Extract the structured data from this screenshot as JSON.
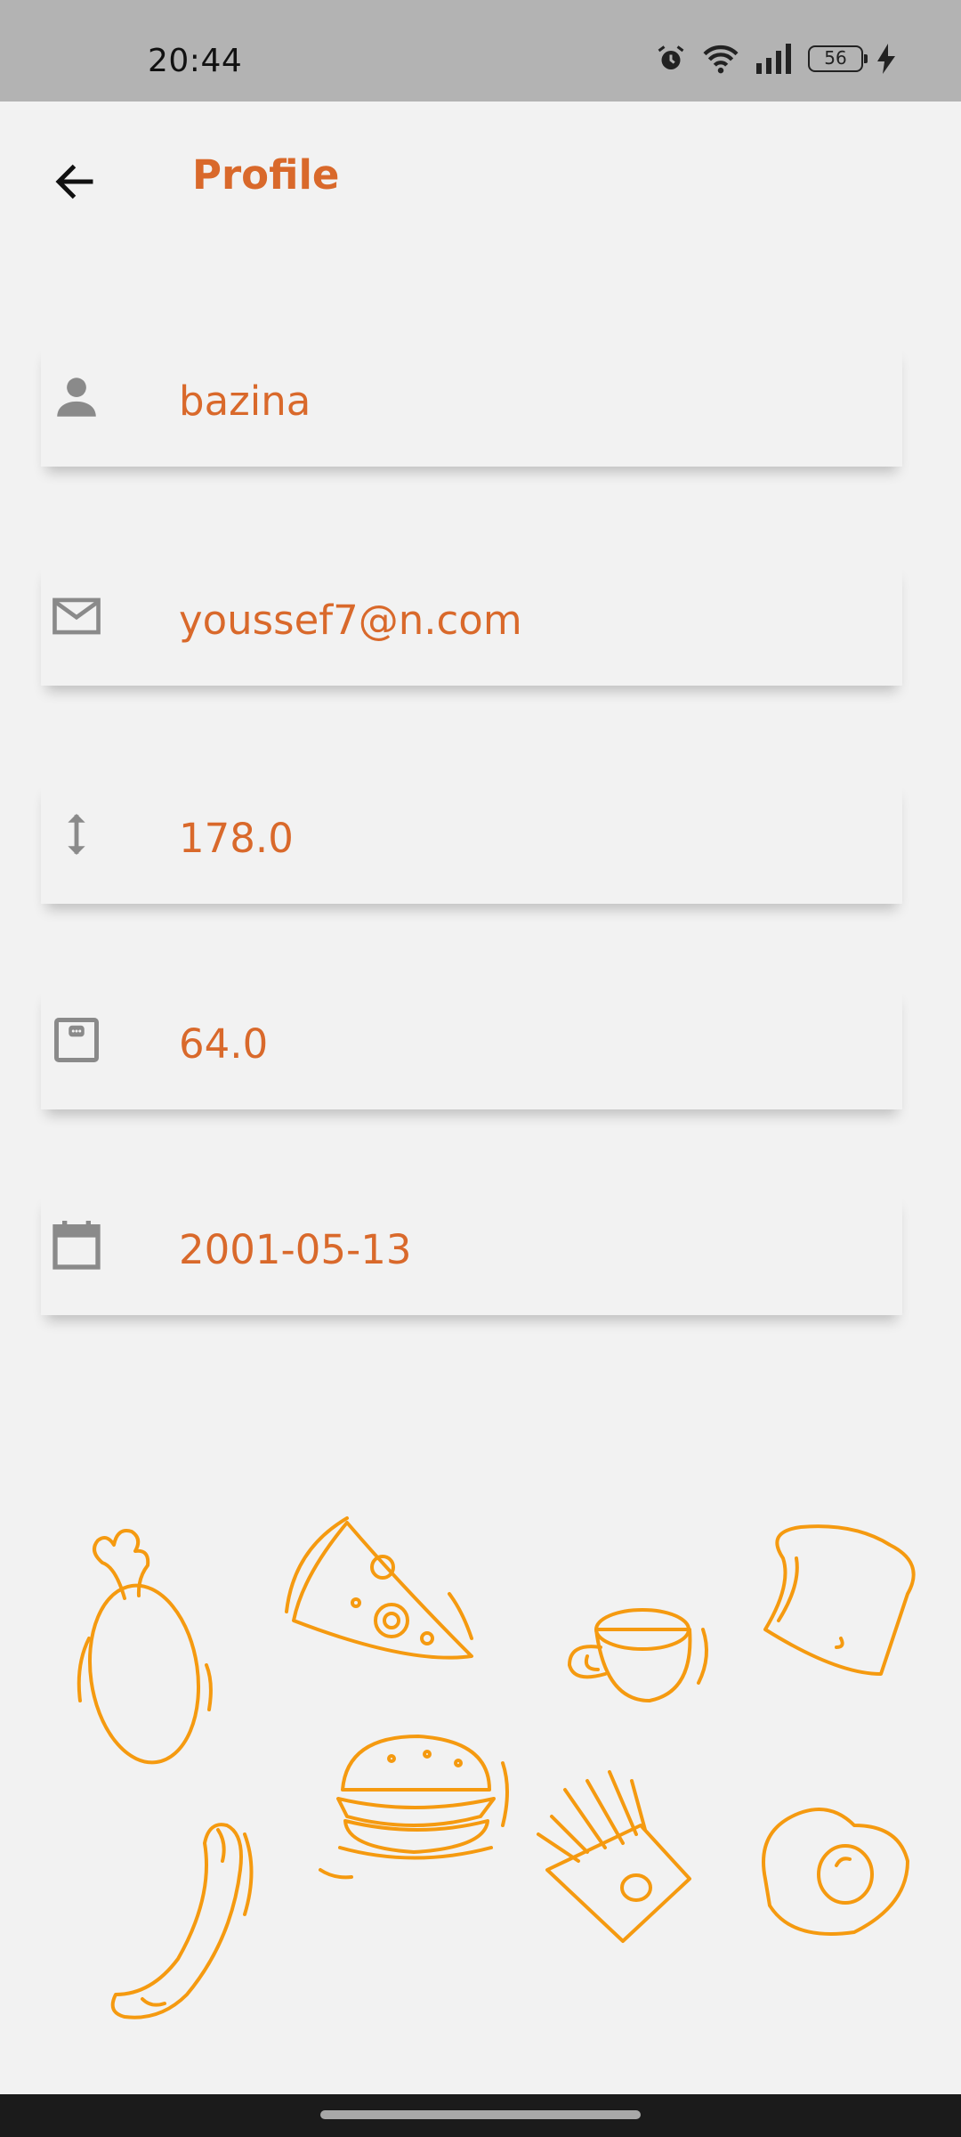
{
  "status_bar": {
    "time": "20:44",
    "battery": "56"
  },
  "header": {
    "title": "Profile",
    "back_icon": "arrow-back-icon"
  },
  "fields": [
    {
      "name": "username",
      "icon": "person-icon",
      "value": "bazina"
    },
    {
      "name": "email",
      "icon": "mail-icon",
      "value": "youssef7@n.com"
    },
    {
      "name": "height",
      "icon": "vertical-arrows-icon",
      "value": "178.0"
    },
    {
      "name": "weight",
      "icon": "scale-icon",
      "value": "64.0"
    },
    {
      "name": "birthdate",
      "icon": "calendar-icon",
      "value": "2001-05-13"
    }
  ],
  "colors": {
    "accent": "#d9692b",
    "icon_gray": "#8a8a8a",
    "food_orange": "#f59a10",
    "background": "#f2f2f2"
  }
}
